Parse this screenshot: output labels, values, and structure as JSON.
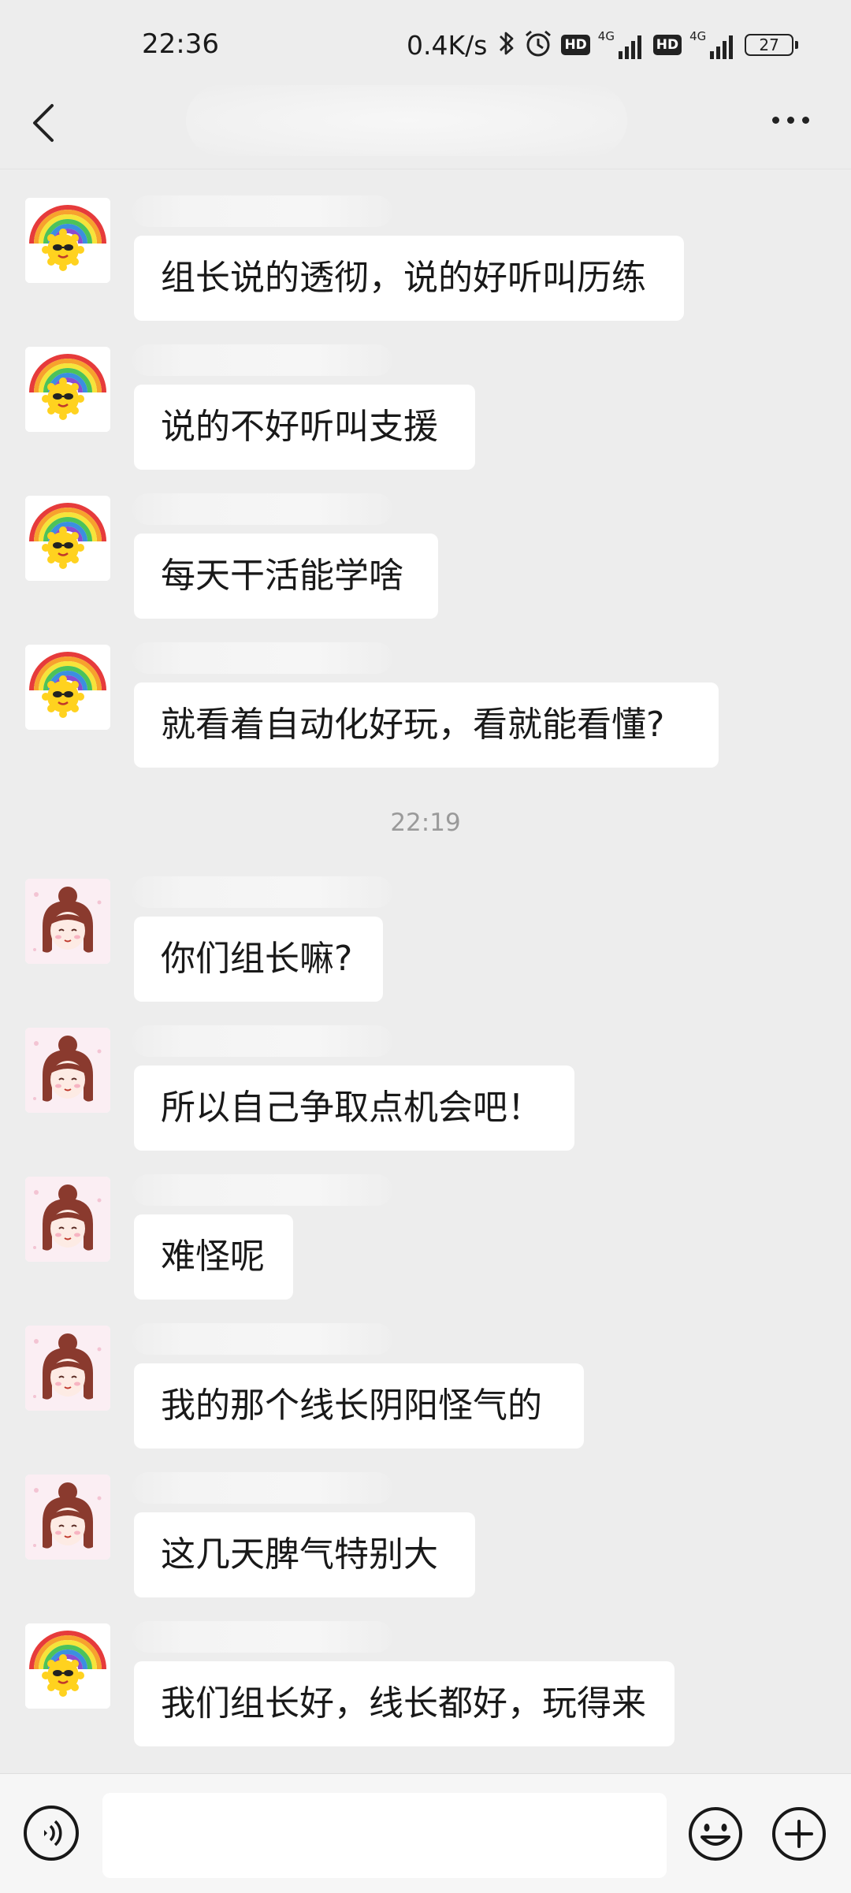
{
  "status_bar": {
    "time": "22:36",
    "network_speed": "0.4K/s",
    "hd_label": "HD",
    "signal_label": "4G",
    "battery": "27"
  },
  "header": {
    "title": "",
    "back_icon": "chevron-left-icon",
    "more_icon": "more-horizontal-icon"
  },
  "messages": [
    {
      "avatar": "sun-rainbow-avatar",
      "sender": "",
      "text": "组长说的透彻，说的好听叫历练"
    },
    {
      "avatar": "sun-rainbow-avatar",
      "sender": "",
      "text": "说的不好听叫支援"
    },
    {
      "avatar": "sun-rainbow-avatar",
      "sender": "",
      "text": "每天干活能学啥"
    },
    {
      "avatar": "sun-rainbow-avatar",
      "sender": "",
      "text": "就看着自动化好玩，看就能看懂?"
    },
    {
      "avatar": "girl-avatar",
      "sender": "",
      "text": "你们组长嘛?"
    },
    {
      "avatar": "girl-avatar",
      "sender": "",
      "text": "所以自己争取点机会吧！"
    },
    {
      "avatar": "girl-avatar",
      "sender": "",
      "text": "难怪呢"
    },
    {
      "avatar": "girl-avatar",
      "sender": "",
      "text": "我的那个线长阴阳怪气的"
    },
    {
      "avatar": "girl-avatar",
      "sender": "",
      "text": "这几天脾气特别大"
    },
    {
      "avatar": "sun-rainbow-avatar",
      "sender": "",
      "text": "我们组长好，线长都好，玩得来"
    }
  ],
  "timestamp": "22:19",
  "input_bar": {
    "placeholder": "",
    "voice_icon": "voice-icon",
    "emoji_icon": "emoji-icon",
    "plus_icon": "plus-icon"
  },
  "colors": {
    "background": "#ededed",
    "bubble": "#ffffff",
    "text": "#191919",
    "timestamp": "#9a9a9a"
  }
}
